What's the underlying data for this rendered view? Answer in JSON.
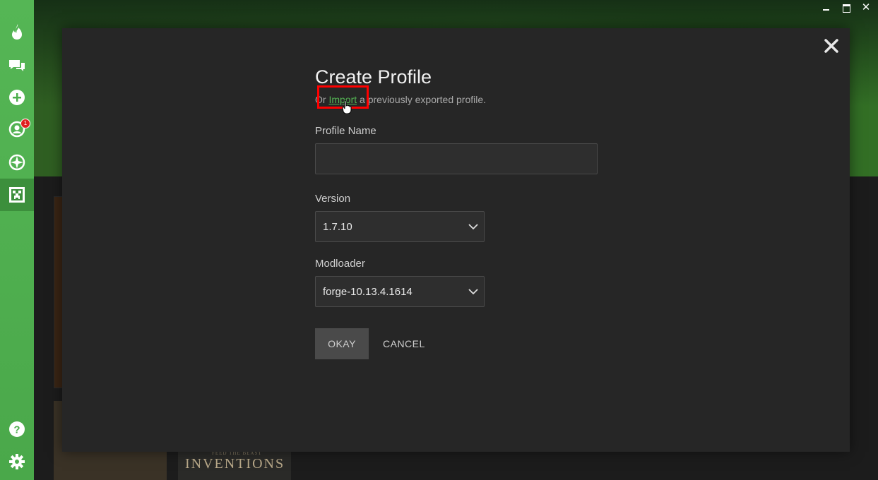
{
  "window": {
    "minimize_icon": "minimize-icon",
    "maximize_icon": "maximize-icon",
    "close_label": "✕"
  },
  "sidebar": {
    "items": [
      {
        "name": "home",
        "icon": "flame-icon"
      },
      {
        "name": "chat",
        "icon": "chat-bubbles-icon"
      },
      {
        "name": "add",
        "icon": "plus-circle-icon"
      },
      {
        "name": "friends",
        "icon": "friends-icon",
        "badge": "1"
      },
      {
        "name": "overwolf",
        "icon": "compass-icon"
      },
      {
        "name": "minecraft",
        "icon": "creeper-icon"
      }
    ],
    "bottom": [
      {
        "name": "help",
        "icon": "help-icon"
      },
      {
        "name": "settings",
        "icon": "gear-icon"
      }
    ],
    "accent": "#55b655"
  },
  "background": {
    "card_title": "INVENTIONS",
    "card_subtitle": "FEED THE BEAST"
  },
  "dialog": {
    "title": "Create Profile",
    "subtitle_prefix": "Or ",
    "import_link": "Import",
    "subtitle_suffix": " a previously exported profile.",
    "profile_name_label": "Profile Name",
    "profile_name_value": "",
    "version_label": "Version",
    "version_value": "1.7.10",
    "modloader_label": "Modloader",
    "modloader_value": "forge-10.13.4.1614",
    "okay_label": "OKAY",
    "cancel_label": "CANCEL",
    "close_icon": "close-icon",
    "link_color": "#55b655",
    "highlight_color": "#ff0000"
  }
}
